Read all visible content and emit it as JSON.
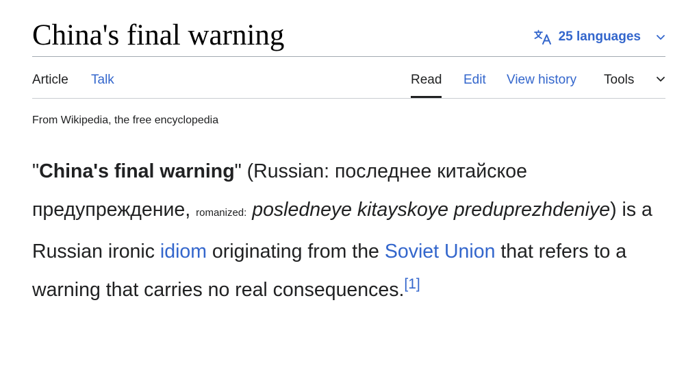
{
  "page": {
    "title": "China's final warning"
  },
  "language_button": {
    "label": "25 languages",
    "icon": "translate-icon",
    "chevron": "chevron-down-icon"
  },
  "tabs": {
    "article": "Article",
    "talk": "Talk",
    "read": "Read",
    "edit": "Edit",
    "view_history": "View history",
    "tools": "Tools"
  },
  "tagline": "From Wikipedia, the free encyclopedia",
  "lead": {
    "open_quote": "\"",
    "subject": "China's final warning",
    "after_subject": "\" (Russian: ",
    "russian": "последнее китайское предупреждение",
    "comma": ", ",
    "romanized_label": "romanized:",
    "space": " ",
    "romanization": "posledneye kitayskoye preduprezhdeniye",
    "after_romanization": ") is a Russian ironic ",
    "link_idiom": "idiom",
    "mid": " originating from the ",
    "link_soviet_union": "Soviet Union",
    "tail": " that refers to a warning that carries no real consequences.",
    "ref": "[1]"
  },
  "colors": {
    "link": "#3366cc",
    "text": "#202122",
    "title": "#000000",
    "divider": "#a2a9b1"
  }
}
